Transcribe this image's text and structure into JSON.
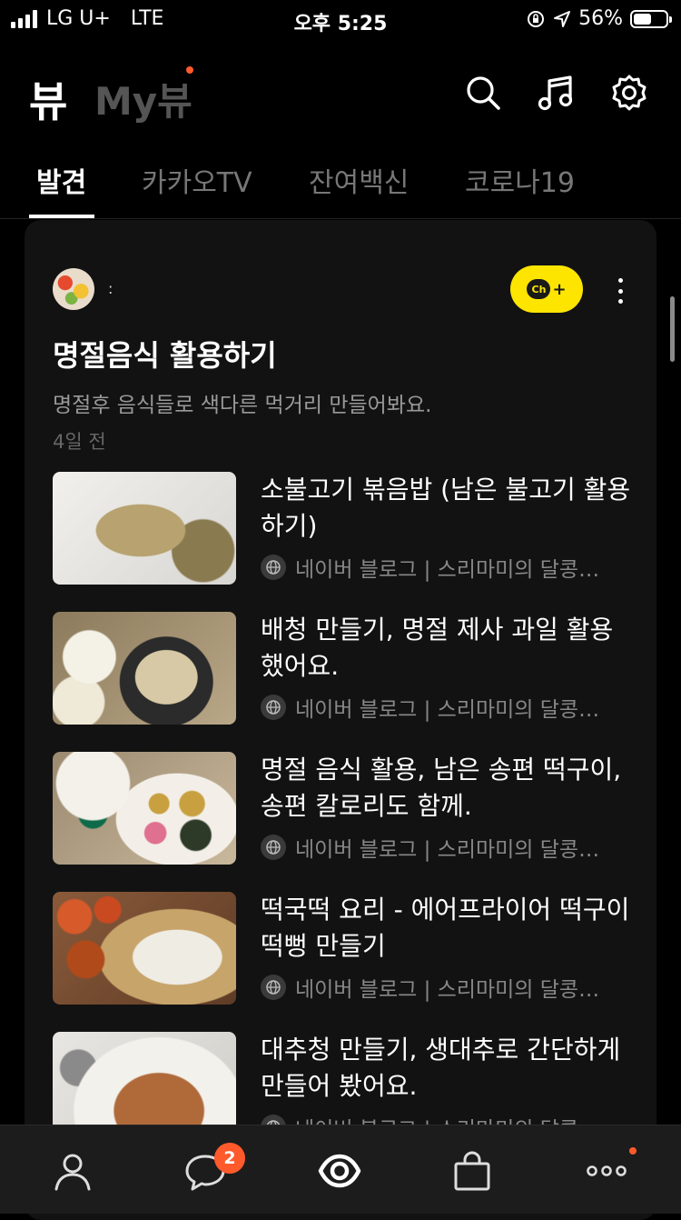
{
  "status_bar": {
    "carrier": "LG U+",
    "network": "LTE",
    "time": "오후 5:25",
    "battery": "56%",
    "battery_level": 0.56
  },
  "header": {
    "title": "뷰",
    "my_view": "My뷰",
    "icons": [
      "search-icon",
      "music-icon",
      "settings-icon"
    ]
  },
  "tabs": [
    {
      "label": "발견",
      "active": true
    },
    {
      "label": "카카오TV",
      "active": false
    },
    {
      "label": "잔여백신",
      "active": false
    },
    {
      "label": "코로나19",
      "active": false
    }
  ],
  "card": {
    "channel_name": ":",
    "channel_add_label": "Ch",
    "title": "명절음식 활용하기",
    "description": "명절후 음식들로 색다른 먹거리 만들어봐요.",
    "date": "4일 전",
    "articles": [
      {
        "title": "소불고기 볶음밥 (남은 불고기 활용하기)",
        "source": "네이버 블로그 | 스리마미의 달콩…"
      },
      {
        "title": "배청 만들기, 명절 제사 과일 활용했어요.",
        "source": "네이버 블로그 | 스리마미의 달콩…"
      },
      {
        "title": "명절 음식 활용, 남은 송편 떡구이, 송편 칼로리도 함께.",
        "source": "네이버 블로그 | 스리마미의 달콩…"
      },
      {
        "title": "떡국떡 요리 - 에어프라이어 떡구이 떡뻥 만들기",
        "source": "네이버 블로그 | 스리마미의 달콩…"
      },
      {
        "title": "대추청 만들기, 생대추로 간단하게 만들어 봤어요.",
        "source": "네이버 블로그 | 스리마미의 달콩…"
      }
    ]
  },
  "bottom_nav": {
    "items": [
      "friends-icon",
      "chat-icon",
      "view-icon",
      "shopping-icon",
      "more-icon"
    ],
    "chat_badge": "2"
  },
  "colors": {
    "background": "#000000",
    "card": "#121212",
    "accent_orange": "#ff5a2b",
    "kakao_yellow": "#fee500"
  }
}
